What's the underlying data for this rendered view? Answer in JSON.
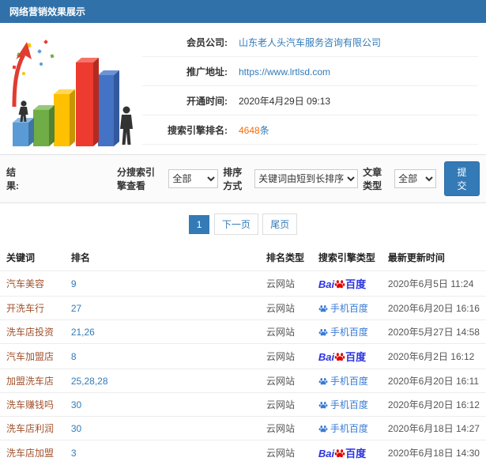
{
  "header": {
    "title": "网络营销效果展示"
  },
  "info": {
    "company_label": "会员公司:",
    "company_value": "山东老人头汽车服务咨询有限公司",
    "url_label": "推广地址:",
    "url_value": "https://www.lrtlsd.com",
    "open_label": "开通时间:",
    "open_value": "2020年4月29日 09:13",
    "rank_label": "搜索引擎排名:",
    "rank_count": "4648",
    "rank_unit": "条"
  },
  "filters": {
    "section_label": "结果:",
    "engine_label": "分搜索引擎查看",
    "engine_value": "全部",
    "sort_label": "排序方式",
    "sort_value": "关键词由短到长排序",
    "type_label": "文章类型",
    "type_value": "全部",
    "submit_label": "提交"
  },
  "pagination": {
    "current": "1",
    "next": "下一页",
    "last": "尾页"
  },
  "table": {
    "headers": [
      "关键词",
      "排名",
      "排名类型",
      "搜索引擎类型",
      "最新更新时间"
    ],
    "engine_display": {
      "baidu_prefix": "Bai",
      "baidu_suffix": "百度",
      "mobile_label": "手机百度"
    },
    "rows": [
      {
        "keyword": "汽车美容",
        "rank": "9",
        "rank_type": "云网站",
        "engine": "baidu",
        "time": "2020年6月5日 11:24"
      },
      {
        "keyword": "开洗车行",
        "rank": "27",
        "rank_type": "云网站",
        "engine": "mobile",
        "time": "2020年6月20日 16:16"
      },
      {
        "keyword": "洗车店投资",
        "rank": "21,26",
        "rank_type": "云网站",
        "engine": "mobile",
        "time": "2020年5月27日 14:58"
      },
      {
        "keyword": "汽车加盟店",
        "rank": "8",
        "rank_type": "云网站",
        "engine": "baidu",
        "time": "2020年6月2日 16:12"
      },
      {
        "keyword": "加盟洗车店",
        "rank": "25,28,28",
        "rank_type": "云网站",
        "engine": "mobile",
        "time": "2020年6月20日 16:11"
      },
      {
        "keyword": "洗车赚钱吗",
        "rank": "30",
        "rank_type": "云网站",
        "engine": "mobile",
        "time": "2020年6月20日 16:12"
      },
      {
        "keyword": "洗车店利润",
        "rank": "30",
        "rank_type": "云网站",
        "engine": "mobile",
        "time": "2020年6月18日 14:27"
      },
      {
        "keyword": "洗车店加盟",
        "rank": "3",
        "rank_type": "云网站",
        "engine": "baidu",
        "time": "2020年6月18日 14:30"
      }
    ]
  },
  "icons": {
    "paw": "baidu-paw-icon",
    "chart": "bar-chart-illustration"
  },
  "colors": {
    "titlebar": "#3071a9",
    "accent": "#337ab7",
    "highlight": "#ff6a00",
    "keyword": "#a0522d",
    "baidu_blue": "#2932e1",
    "baidu_red": "#e10601",
    "mobile_blue": "#3a7bd5",
    "row_border": "#ececec"
  }
}
